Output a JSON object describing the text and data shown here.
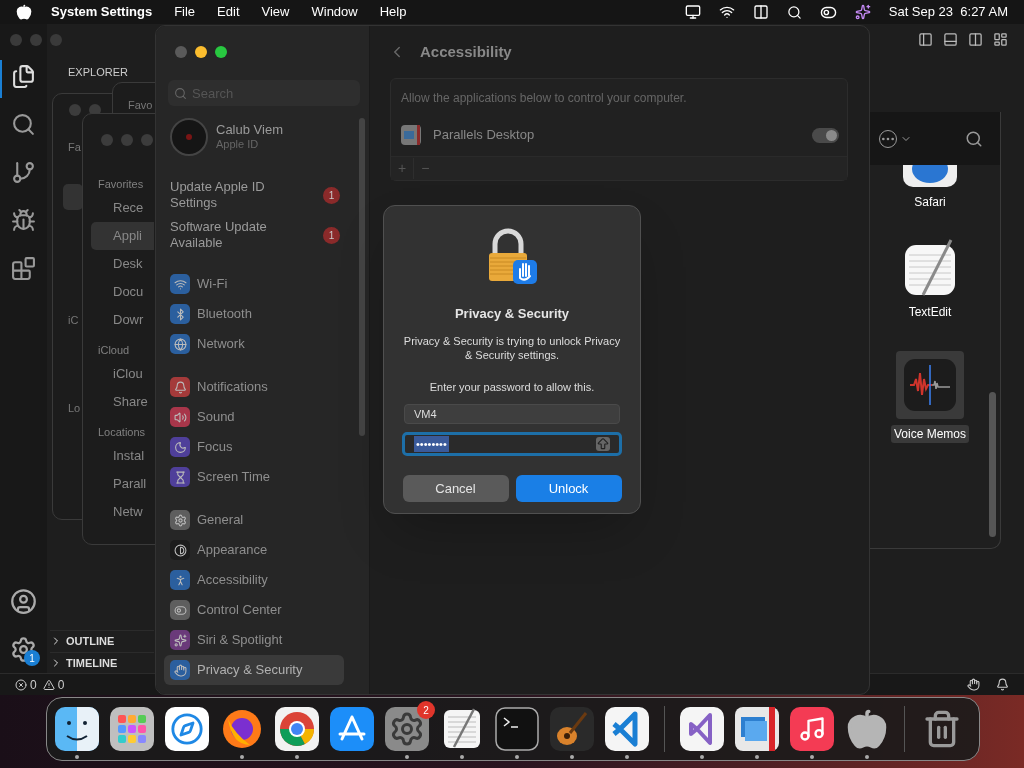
{
  "menu_bar": {
    "app_name": "System Settings",
    "menus": [
      "File",
      "Edit",
      "View",
      "Window",
      "Help"
    ],
    "clock": "Sat Sep 23  6:27 AM"
  },
  "editor": {
    "explorer_title": "EXPLORER",
    "panels": [
      {
        "label": "OUTLINE",
        "expanded": false
      },
      {
        "label": "TIMELINE",
        "expanded": false
      }
    ],
    "settings_badge": "1",
    "status": {
      "errors": "0",
      "warnings": "0"
    }
  },
  "finder_windows_behind": {
    "back_labels": [
      "Fa",
      "iC",
      "Lo"
    ],
    "middle_label": "Favo"
  },
  "finder_front": {
    "sidebar": [
      {
        "kind": "heading",
        "label": "Favorites"
      },
      {
        "kind": "item",
        "label": "Rece",
        "selected": false
      },
      {
        "kind": "item",
        "label": "Appli",
        "selected": true
      },
      {
        "kind": "item",
        "label": "Desk",
        "selected": false
      },
      {
        "kind": "item",
        "label": "Docu",
        "selected": false
      },
      {
        "kind": "item",
        "label": "Dowr",
        "selected": false
      },
      {
        "kind": "heading",
        "label": "iCloud"
      },
      {
        "kind": "item",
        "label": "iClou",
        "selected": false
      },
      {
        "kind": "item",
        "label": "Share",
        "selected": false
      },
      {
        "kind": "heading",
        "label": "Locations"
      },
      {
        "kind": "item",
        "label": "Instal",
        "selected": false
      },
      {
        "kind": "item",
        "label": "Parall",
        "selected": false
      },
      {
        "kind": "item",
        "label": "Netw",
        "selected": false
      }
    ]
  },
  "settings": {
    "search_placeholder": "Search",
    "account": {
      "name": "Calub Viem",
      "subtitle": "Apple ID"
    },
    "notices": [
      {
        "label": "Update Apple ID Settings",
        "badge": "1"
      },
      {
        "label": "Software Update Available",
        "badge": "1"
      }
    ],
    "groups": [
      [
        {
          "label": "Wi-Fi",
          "kind": "wifi",
          "color": "#2b5f9e",
          "selected": false
        },
        {
          "label": "Bluetooth",
          "kind": "bluetooth",
          "color": "#2b5f9e",
          "selected": false
        },
        {
          "label": "Network",
          "kind": "network",
          "color": "#2b5f9e",
          "selected": false
        }
      ],
      [
        {
          "label": "Notifications",
          "kind": "bell",
          "color": "#a43a3a",
          "selected": false
        },
        {
          "label": "Sound",
          "kind": "sound",
          "color": "#a8364a",
          "selected": false
        },
        {
          "label": "Focus",
          "kind": "moon",
          "color": "#4f3f9a",
          "selected": false
        },
        {
          "label": "Screen Time",
          "kind": "hourglass",
          "color": "#4f3f9a",
          "selected": false
        }
      ],
      [
        {
          "label": "General",
          "kind": "gear",
          "color": "#5e5e5e",
          "selected": false
        },
        {
          "label": "Appearance",
          "kind": "contrast",
          "color": "#1c1c1c",
          "selected": false
        },
        {
          "label": "Accessibility",
          "kind": "person",
          "color": "#2b5f9e",
          "selected": false
        },
        {
          "label": "Control Center",
          "kind": "toggles",
          "color": "#5e5e5e",
          "selected": false
        },
        {
          "label": "Siri & Spotlight",
          "kind": "siri",
          "color": "#6a3a7a",
          "selected": false
        },
        {
          "label": "Privacy & Security",
          "kind": "hand",
          "color": "#2b5f9e",
          "selected": true
        }
      ]
    ],
    "page_title": "Accessibility",
    "description": "Allow the applications below to control your computer.",
    "apps": [
      {
        "name": "Parallels Desktop",
        "on": true
      }
    ],
    "add": "+",
    "remove": "−"
  },
  "dialog": {
    "title": "Privacy & Security",
    "message": "Privacy & Security is trying to unlock Privacy & Security settings.",
    "prompt": "Enter your password to allow this.",
    "username": "VM4",
    "password": "••••••••",
    "password_focused": true,
    "buttons": [
      {
        "label": "Cancel",
        "kind": "secondary"
      },
      {
        "label": "Unlock",
        "kind": "primary"
      }
    ]
  },
  "finder_apps": {
    "items": [
      {
        "name": "Safari",
        "kind": "safari",
        "selected": false
      },
      {
        "name": "TextEdit",
        "kind": "textedit",
        "selected": false
      },
      {
        "name": "Voice Memos",
        "kind": "voicememos",
        "selected": true
      }
    ]
  },
  "dock": {
    "items": [
      {
        "kind": "finder",
        "running": true
      },
      {
        "kind": "launchpad",
        "running": false
      },
      {
        "kind": "safari",
        "running": false
      },
      {
        "kind": "firefox",
        "running": true
      },
      {
        "kind": "chrome",
        "running": true
      },
      {
        "kind": "appstore",
        "running": false
      },
      {
        "kind": "settings",
        "running": true,
        "badge": "2"
      },
      {
        "kind": "textedit",
        "running": true
      },
      {
        "kind": "terminal",
        "running": true
      },
      {
        "kind": "guitar",
        "running": true
      },
      {
        "kind": "vscode",
        "running": true
      },
      {
        "kind": "separator"
      },
      {
        "kind": "vs",
        "running": true
      },
      {
        "kind": "parallels",
        "running": true
      },
      {
        "kind": "music",
        "running": true
      },
      {
        "kind": "apple",
        "running": true
      },
      {
        "kind": "separator"
      },
      {
        "kind": "trash",
        "running": false
      }
    ]
  }
}
